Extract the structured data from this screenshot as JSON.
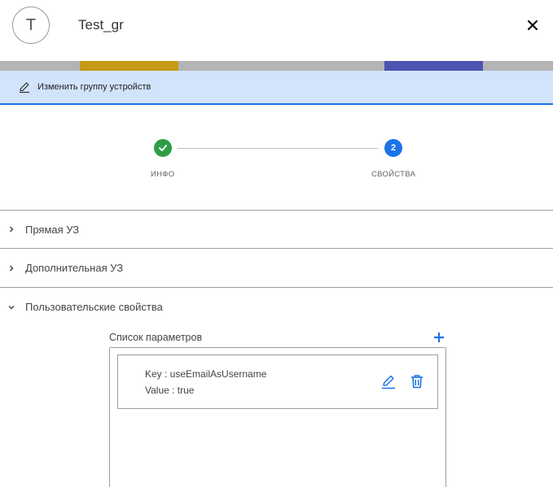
{
  "header": {
    "avatar_letter": "T",
    "title": "Test_gr"
  },
  "edit_bar": {
    "label": "Изменить группу устройств"
  },
  "stepper": {
    "steps": [
      {
        "label": "ИНФО",
        "state": "done"
      },
      {
        "label": "СВОЙСТВА",
        "state": "active",
        "number": "2"
      }
    ]
  },
  "sections": [
    {
      "label": "Прямая УЗ",
      "expanded": false
    },
    {
      "label": "Дополнительная УЗ",
      "expanded": false
    },
    {
      "label": "Пользовательские свойства",
      "expanded": true
    }
  ],
  "params": {
    "title": "Список параметров",
    "items": [
      {
        "key_text": "Key : useEmailAsUsername",
        "value_text": "Value : true"
      }
    ]
  },
  "colors": {
    "accent": "#1a73e8",
    "success": "#2e9e45",
    "edit_bar_bg": "#d2e3fc"
  }
}
